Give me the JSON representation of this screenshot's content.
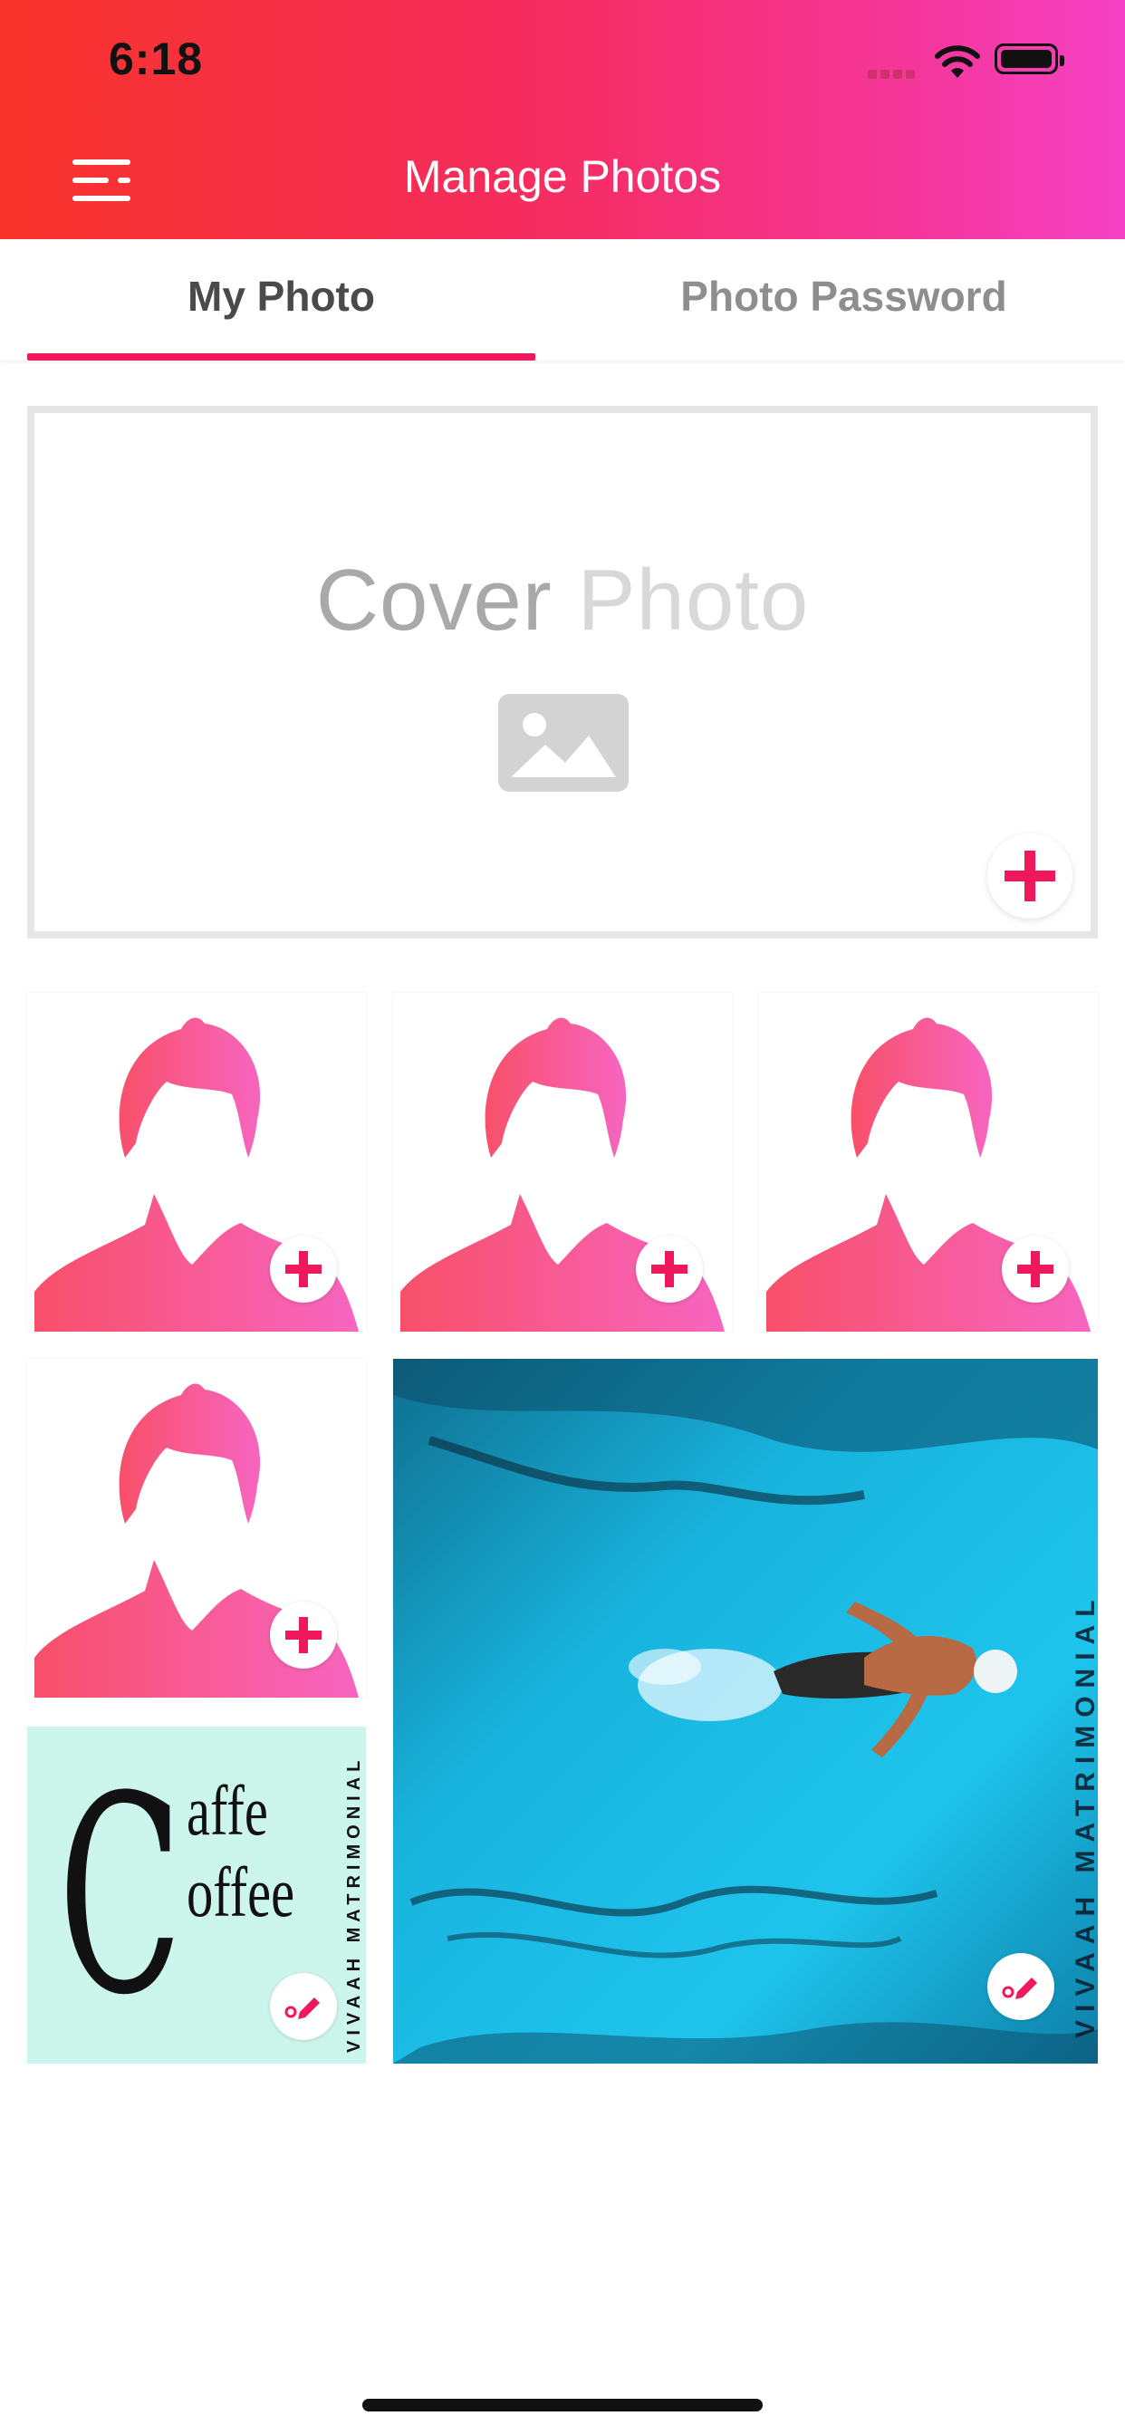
{
  "status_bar": {
    "time": "6:18"
  },
  "header": {
    "title": "Manage Photos",
    "menu_icon": "hamburger-menu-icon"
  },
  "tabs": [
    {
      "label": "My Photo",
      "active": true
    },
    {
      "label": "Photo Password",
      "active": false
    }
  ],
  "cover": {
    "text_primary": "Cover ",
    "text_secondary": "Photo",
    "icon": "image-placeholder-icon",
    "add_icon": "plus-icon"
  },
  "photo_grid": {
    "placeholder_count": 4,
    "placeholder_icon": "female-avatar-placeholder-icon",
    "add_icon": "plus-icon",
    "uploaded": [
      {
        "name": "caffe-coffee-photo",
        "line1": "affe",
        "line2": "offee",
        "initial": "C",
        "watermark": "VIVAAH MATRIMONIAL"
      },
      {
        "name": "swimmer-photo",
        "watermark": "VIVAAH MATRIMONIAL"
      }
    ],
    "edit_icon": "edit-pencil-icon"
  },
  "colors": {
    "accent": "#f0185c",
    "header_gradient": [
      "#f8342a",
      "#f52c5c",
      "#f5348e",
      "#f540c4"
    ],
    "avatar_gradient": [
      "#f8506a",
      "#f765c0"
    ]
  }
}
